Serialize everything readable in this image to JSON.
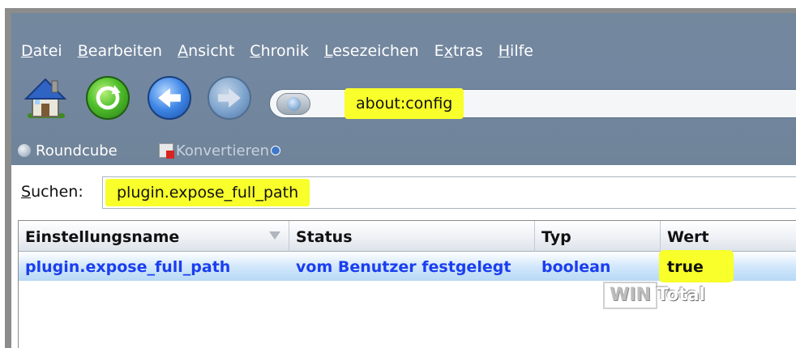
{
  "menu": {
    "items": [
      {
        "pre": "",
        "u": "D",
        "post": "atei"
      },
      {
        "pre": "",
        "u": "B",
        "post": "earbeiten"
      },
      {
        "pre": "",
        "u": "A",
        "post": "nsicht"
      },
      {
        "pre": "",
        "u": "C",
        "post": "hronik"
      },
      {
        "pre": "",
        "u": "L",
        "post": "esezeichen"
      },
      {
        "pre": "E",
        "u": "x",
        "post": "tras"
      },
      {
        "pre": "",
        "u": "H",
        "post": "ilfe"
      }
    ]
  },
  "toolbar": {
    "url": "about:config"
  },
  "bookmarks": {
    "roundcube": "Roundcube",
    "convert": "Konvertieren"
  },
  "search": {
    "label_u": "S",
    "label_rest": "uchen:",
    "value": "plugin.expose_full_path"
  },
  "table": {
    "headers": {
      "name": "Einstellungsname",
      "status": "Status",
      "typ": "Typ",
      "wert": "Wert"
    },
    "rows": [
      {
        "name": "plugin.expose_full_path",
        "status": "vom Benutzer festgelegt",
        "typ": "boolean",
        "wert": "true"
      }
    ]
  },
  "watermark": {
    "left": "WIN",
    "right": "Total"
  },
  "colors": {
    "highlight": "#f8ff2a",
    "link_blue": "#1b3ef0",
    "chrome_bg": "#7387a0"
  }
}
